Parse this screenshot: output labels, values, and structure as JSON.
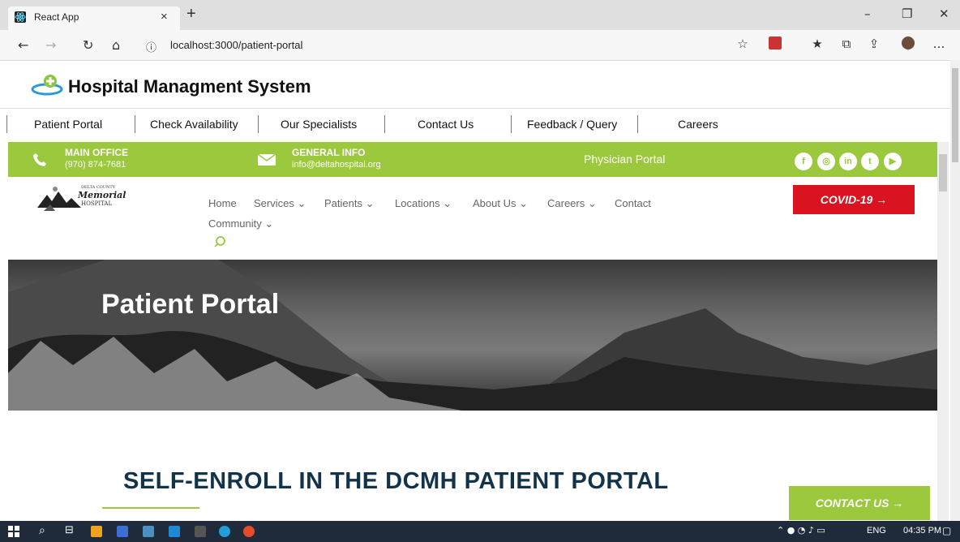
{
  "browser": {
    "tab_title": "React App",
    "url": "localhost:3000/patient-portal"
  },
  "app": {
    "title": "Hospital Managment System",
    "nav": [
      "Patient Portal",
      "Check Availability",
      "Our Specialists",
      "Contact Us",
      "Feedback / Query",
      "Careers"
    ]
  },
  "infobar": {
    "main_office_label": "MAIN OFFICE",
    "main_office_phone": "(970) 874-7681",
    "general_info_label": "GENERAL INFO",
    "general_info_email": "info@deltahospital.org",
    "physician_portal": "Physician Portal"
  },
  "hospital": {
    "logo_line1": "DELTA COUNTY",
    "logo_line2": "Memorial",
    "logo_line3": "HOSPITAL",
    "nav": [
      "Home",
      "Services ⌄",
      "Patients ⌄",
      "Locations ⌄",
      "About Us ⌄",
      "Careers ⌄",
      "Contact"
    ],
    "community": "Community ⌄",
    "covid_button": "COVID-19 →"
  },
  "hero": {
    "title": "Patient Portal"
  },
  "content": {
    "heading": "SELF-ENROLL IN THE DCMH PATIENT PORTAL",
    "contact_button": "CONTACT US →"
  },
  "taskbar": {
    "lang": "ENG",
    "time": "04:35 PM"
  },
  "colors": {
    "accent_green": "#9bc83c",
    "covid_red": "#d9131f",
    "heading_navy": "#12334a"
  },
  "icons": [
    "react-icon",
    "close-icon",
    "plus-icon",
    "back-icon",
    "forward-icon",
    "refresh-icon",
    "home-icon",
    "info-icon",
    "star-icon",
    "phone-icon",
    "mail-icon",
    "facebook-icon",
    "instagram-icon",
    "linkedin-icon",
    "twitter-icon",
    "youtube-icon",
    "search-icon"
  ]
}
